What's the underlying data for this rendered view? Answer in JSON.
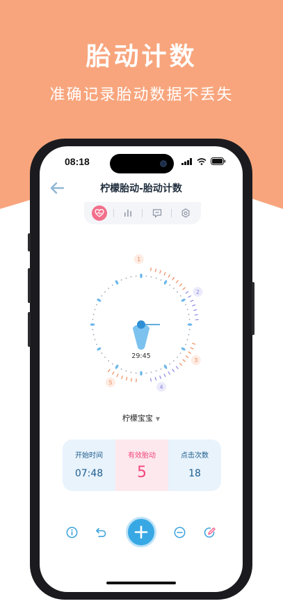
{
  "promo": {
    "title": "胎动计数",
    "subtitle": "准确记录胎动数据不丢失",
    "background_color": "#f8a57d"
  },
  "status_bar": {
    "time": "08:18",
    "icons": [
      "signal-icon",
      "wifi-icon",
      "battery-icon"
    ]
  },
  "nav": {
    "title": "柠檬胎动-胎动计数",
    "back_icon": "back-arrow-icon"
  },
  "tabs": [
    {
      "icon": "heart-icon",
      "active": true
    },
    {
      "icon": "bar-chart-icon",
      "active": false
    },
    {
      "icon": "message-icon",
      "active": false
    },
    {
      "icon": "settings-icon",
      "active": false
    }
  ],
  "clock": {
    "time": "29:45",
    "session_markers": [
      "1",
      "2",
      "3",
      "4",
      "5"
    ],
    "marker_colors": [
      "#f08a5d",
      "#8a86e0",
      "#f08a5d",
      "#8a86e0",
      "#f08a5d"
    ]
  },
  "baby": {
    "name": "柠檬宝宝"
  },
  "stats": {
    "start_time_label": "开始时间",
    "start_time_value": "07:48",
    "valid_label": "有效胎动",
    "valid_value": "5",
    "clicks_label": "点击次数",
    "clicks_value": "18"
  },
  "toolbar": {
    "items": [
      "info-icon",
      "undo-icon",
      "add-icon",
      "minus-icon",
      "edit-icon"
    ]
  },
  "colors": {
    "accent_blue": "#38a8e4",
    "accent_pink": "#f2477a",
    "tab_active": "#f26f8b"
  }
}
